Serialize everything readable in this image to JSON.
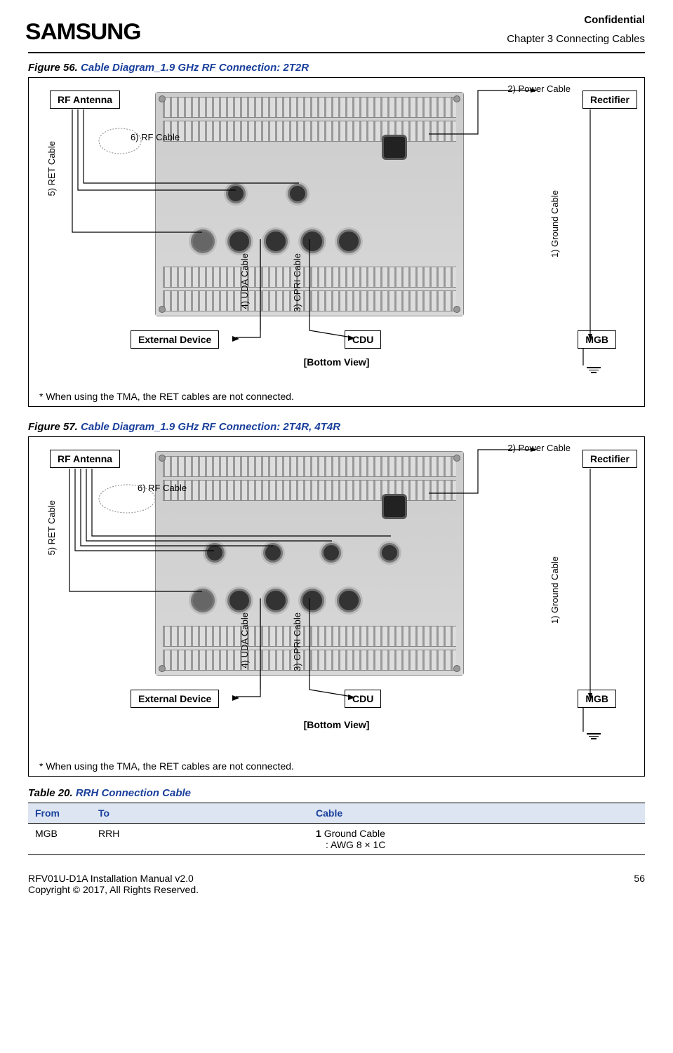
{
  "header": {
    "confidential": "Confidential",
    "chapter": "Chapter 3 Connecting Cables",
    "brand": "SAMSUNG"
  },
  "figure56": {
    "label": "Figure 56.",
    "title": "Cable Diagram_1.9 GHz RF Connection: 2T2R",
    "rf_antenna": "RF Antenna",
    "rectifier": "Rectifier",
    "external_device": "External Device",
    "cdu": "CDU",
    "mgb": "MGB",
    "power_cable": "2)  Power Cable",
    "ground_cable": "1)  Ground Cable",
    "ret_cable": "5)  RET Cable",
    "rf_cable": "6)  RF Cable",
    "uda_cable": "4)  UDA Cable",
    "cpri_cable": "3)  CPRI Cable",
    "bottom_view": "[Bottom View]",
    "note": "* When using the TMA, the RET cables are not connected."
  },
  "figure57": {
    "label": "Figure 57.",
    "title": "Cable Diagram_1.9 GHz RF Connection: 2T4R, 4T4R",
    "rf_antenna": "RF Antenna",
    "rectifier": "Rectifier",
    "external_device": "External Device",
    "cdu": "CDU",
    "mgb": "MGB",
    "power_cable": "2)  Power Cable",
    "ground_cable": "1)  Ground Cable",
    "ret_cable": "5)  RET Cable",
    "rf_cable": "6)  RF Cable",
    "uda_cable": "4)  UDA Cable",
    "cpri_cable": "3)  CPRI Cable",
    "bottom_view": "[Bottom View]",
    "note": "* When using the TMA, the RET cables are not connected."
  },
  "table20": {
    "label": "Table 20.",
    "title": "RRH Connection Cable",
    "headers": {
      "from": "From",
      "to": "To",
      "cable": "Cable"
    },
    "rows": [
      {
        "from": "MGB",
        "to": "RRH",
        "cable_num": "1",
        "cable_name": "Ground Cable",
        "cable_spec": ": AWG 8 × 1C"
      }
    ]
  },
  "footer": {
    "left1": "RFV01U-D1A Installation Manual   v2.0",
    "left2": "Copyright © 2017, All Rights Reserved.",
    "page": "56"
  }
}
